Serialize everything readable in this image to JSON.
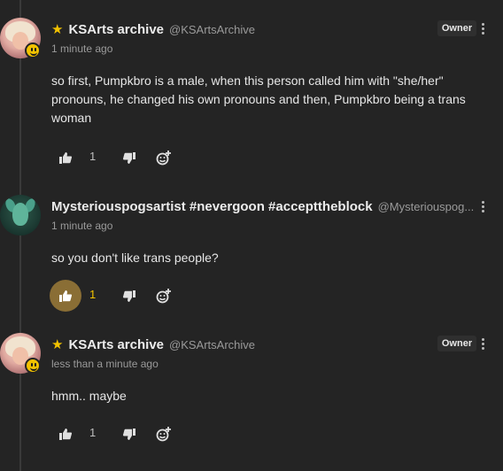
{
  "comments": [
    {
      "author": "KSArts archive",
      "handle": "@KSArtsArchive",
      "time": "1 minute ago",
      "owner_label": "Owner",
      "text": "so first, Pumpkbro is a male, when this person called him with \"she/her\" pronouns, he changed his own pronouns and then, Pumpkbro being a trans woman",
      "likes": "1",
      "liked": false
    },
    {
      "author": "Mysteriouspogsartist #nevergoon #accepttheblock",
      "handle": "@Mysteriouspog...",
      "time": "1 minute ago",
      "text": "so you don't like trans people?",
      "likes": "1",
      "liked": true
    },
    {
      "author": "KSArts archive",
      "handle": "@KSArtsArchive",
      "time": "less than a minute ago",
      "owner_label": "Owner",
      "text": "hmm.. maybe",
      "likes": "1",
      "liked": false
    }
  ],
  "icons": {
    "star": "star-icon",
    "like": "thumbs-up-icon",
    "dislike": "thumbs-down-icon",
    "react": "emoji-add-icon",
    "more": "more-vertical-icon",
    "avatar_badge": "smiley-badge-icon"
  },
  "colors": {
    "background": "#242424",
    "accent": "#f2c200",
    "liked_bg": "#8a6e35"
  }
}
